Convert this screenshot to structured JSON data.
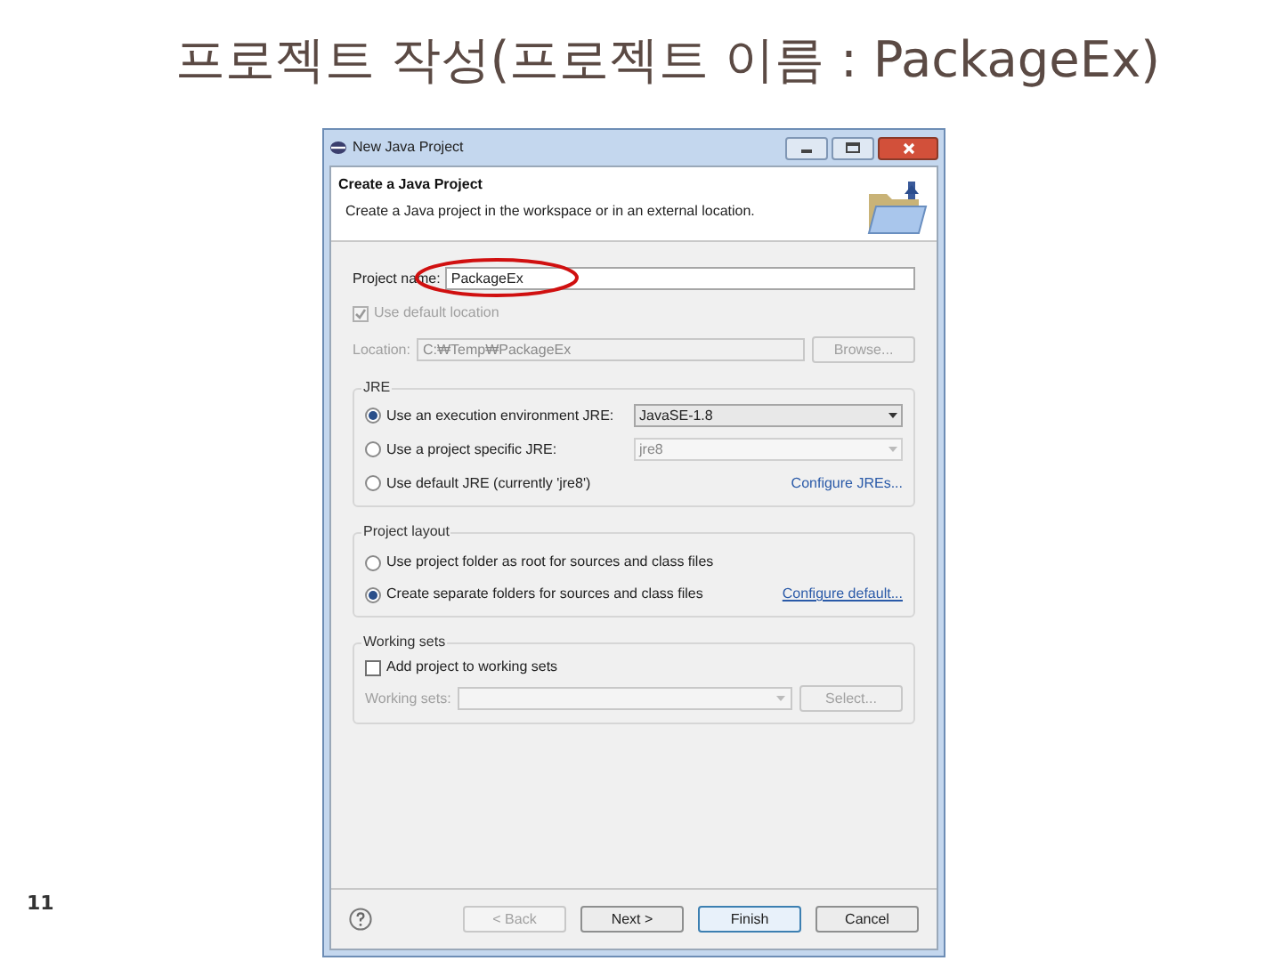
{
  "slide": {
    "title": "프로젝트 작성(프로젝트 이름 : PackageEx)",
    "page_number": "11"
  },
  "window": {
    "title": "New Java Project"
  },
  "header": {
    "title": "Create a Java Project",
    "description": "Create a Java project in the workspace or in an external location."
  },
  "project_name": {
    "label": "Project name:",
    "value": "PackageEx",
    "circled": true
  },
  "default_location": {
    "label": "Use default location",
    "checked": true,
    "disabled": true
  },
  "location": {
    "label": "Location:",
    "value": "C:₩Temp₩PackageEx",
    "disabled": true,
    "button": "Browse..."
  },
  "jre": {
    "title": "JRE",
    "link": "Configure JREs...",
    "options": [
      {
        "label": "Use an execution environment JRE:",
        "selected": true,
        "dropdown": "JavaSE-1.8",
        "dropdown_disabled": false
      },
      {
        "label": "Use a project specific JRE:",
        "selected": false,
        "dropdown": "jre8",
        "dropdown_disabled": true
      },
      {
        "label": "Use default JRE (currently 'jre8')",
        "selected": false
      }
    ]
  },
  "layout": {
    "title": "Project layout",
    "link": "Configure default...",
    "options": [
      {
        "label": "Use project folder as root for sources and class files",
        "selected": false
      },
      {
        "label": "Create separate folders for sources and class files",
        "selected": true
      }
    ]
  },
  "working_sets": {
    "title": "Working sets",
    "checkbox": {
      "label": "Add project to working sets",
      "checked": false
    },
    "field_label": "Working sets:",
    "button": "Select...",
    "disabled": true
  },
  "buttons": [
    {
      "label": "< Back",
      "disabled": true,
      "default": false
    },
    {
      "label": "Next >",
      "disabled": false,
      "default": false
    },
    {
      "label": "Finish",
      "disabled": false,
      "default": true
    },
    {
      "label": "Cancel",
      "disabled": false,
      "default": false
    }
  ]
}
